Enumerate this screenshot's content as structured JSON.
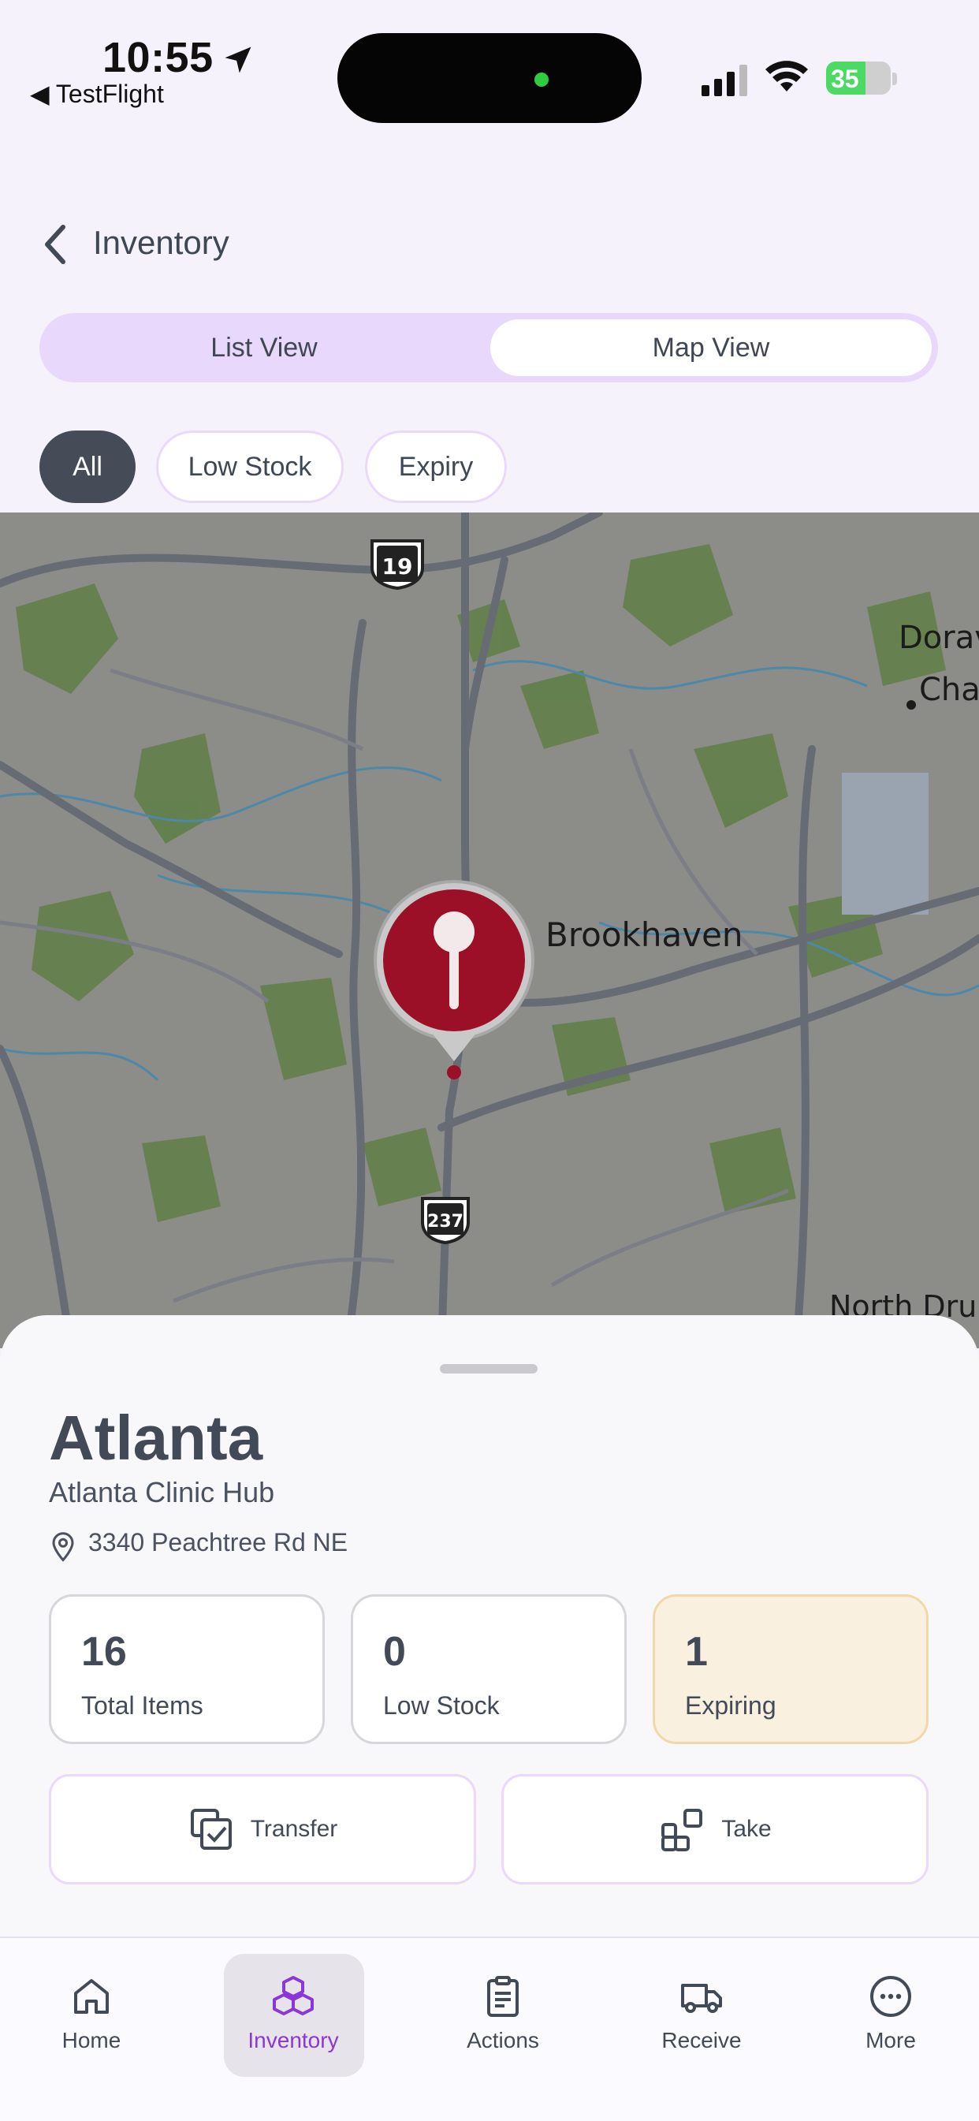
{
  "status_bar": {
    "time": "10:55",
    "back_app": "◀ TestFlight",
    "battery": "35"
  },
  "nav": {
    "title": "Inventory"
  },
  "segments": {
    "list": "List View",
    "map": "Map View",
    "selected": "Map View"
  },
  "filters": {
    "all": "All",
    "low_stock": "Low Stock",
    "expiry": "Expiry",
    "selected": "All"
  },
  "map": {
    "labels": {
      "brookhaven": "Brookhaven",
      "doraville": "Dorav",
      "chamblee": "Cha",
      "north_druid": "North Dru",
      "route_19": "19",
      "route_237": "237"
    },
    "colors": {
      "marker": "#9b1027",
      "base": "#8c8c89"
    }
  },
  "location": {
    "city": "Atlanta",
    "name": "Atlanta Clinic Hub",
    "address": "3340 Peachtree Rd NE"
  },
  "stats": {
    "total": {
      "value": "16",
      "label": "Total Items"
    },
    "low": {
      "value": "0",
      "label": "Low Stock"
    },
    "expiring": {
      "value": "1",
      "label": "Expiring"
    }
  },
  "actions": {
    "transfer": "Transfer",
    "take": "Take"
  },
  "tabs": {
    "home": "Home",
    "inventory": "Inventory",
    "actions": "Actions",
    "receive": "Receive",
    "more": "More",
    "active": "Inventory"
  },
  "accent": "#8a36d8"
}
